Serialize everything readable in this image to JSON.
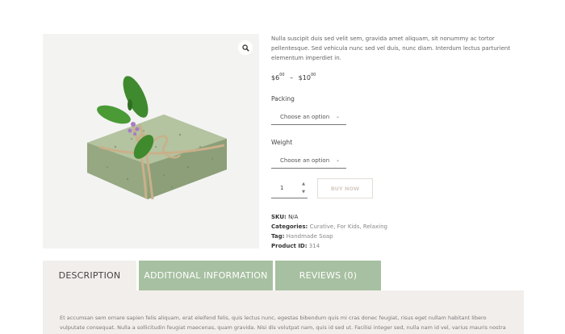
{
  "product": {
    "short_description": "Nulla suscipit duis sed velit sem, gravida amet aliquam, sit nonummy ac tortor pellentesque. Sed vehicula nunc sed vel duis, nunc diam. Interdum lectus parturient elementum imperdiet in.",
    "price": {
      "min_currency": "$",
      "min_amount": "6",
      "min_cents": "00",
      "dash": "–",
      "max_currency": "$",
      "max_amount": "10",
      "max_cents": "00"
    },
    "image_icon": "product-soap-image"
  },
  "gallery": {
    "zoom_icon": "magnifier-icon"
  },
  "options": {
    "packing_label": "Packing",
    "packing_select": "Choose an option",
    "weight_label": "Weight",
    "weight_select": "Choose an option"
  },
  "cart": {
    "quantity": "1",
    "buy_label": "BUY NOW"
  },
  "meta": {
    "sku_label": "SKU:",
    "sku_value": "N/A",
    "categories_label": "Categories:",
    "categories": [
      "Curative",
      "For Kids",
      "Relaxing"
    ],
    "tag_label": "Tag:",
    "tag_value": "Handmade Soap",
    "product_id_label": "Product ID:",
    "product_id_value": "314"
  },
  "tabs": [
    {
      "label": "DESCRIPTION",
      "active": true
    },
    {
      "label": "ADDITIONAL INFORMATION",
      "active": false
    },
    {
      "label": "REVIEWS (0)",
      "active": false
    }
  ],
  "description_text": "Et accumsan sem ornare sapien felis aliquam, erat eleifend felis, quis lectus nunc, egestas bibendum quis mi cras donec feugiat, risus eget nullam habitant libero vulputate consequat. Nulla a sollicitudin feugiat maecenas, quam gravida. Nisi dis volutpat nam, quis id sed ut. Facilisi integer sed, nulla nam id vel, varius mauris nostra tincidunt turpis",
  "colors": {
    "tab_inactive_bg": "#a7c0a1",
    "panel_bg": "#f2eeec",
    "buy_button_border": "#e4dcd6"
  }
}
